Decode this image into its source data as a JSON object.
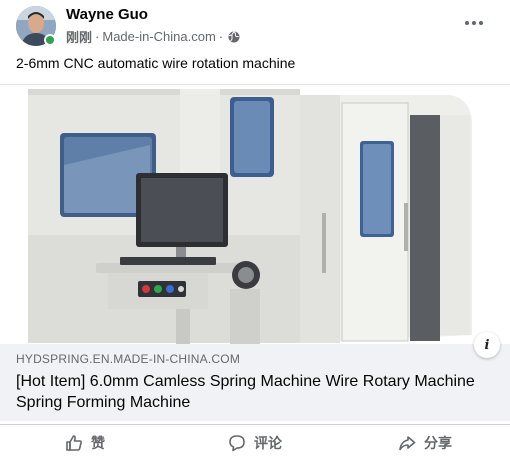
{
  "post": {
    "author": "Wayne Guo",
    "time": "刚刚",
    "separator": "·",
    "source": "Made-in-China.com",
    "separator2": "·",
    "text": "2-6mm CNC automatic wire rotation machine"
  },
  "link": {
    "domain": "HYDSPRING.EN.MADE-IN-CHINA.COM",
    "title": "[Hot Item] 6.0mm Camless Spring Machine Wire Rotary Machine Spring Forming Machine"
  },
  "actions": {
    "like": "赞",
    "comment": "评论",
    "share": "分享"
  },
  "icons": {
    "more": "more-options-icon",
    "privacy": "globe-icon",
    "info": "info-icon",
    "like": "thumbs-up-icon",
    "comment": "comment-icon",
    "share": "share-icon"
  },
  "colors": {
    "secondary_text": "#65676b",
    "link_footer_bg": "#f0f2f5",
    "online": "#31a24c"
  }
}
